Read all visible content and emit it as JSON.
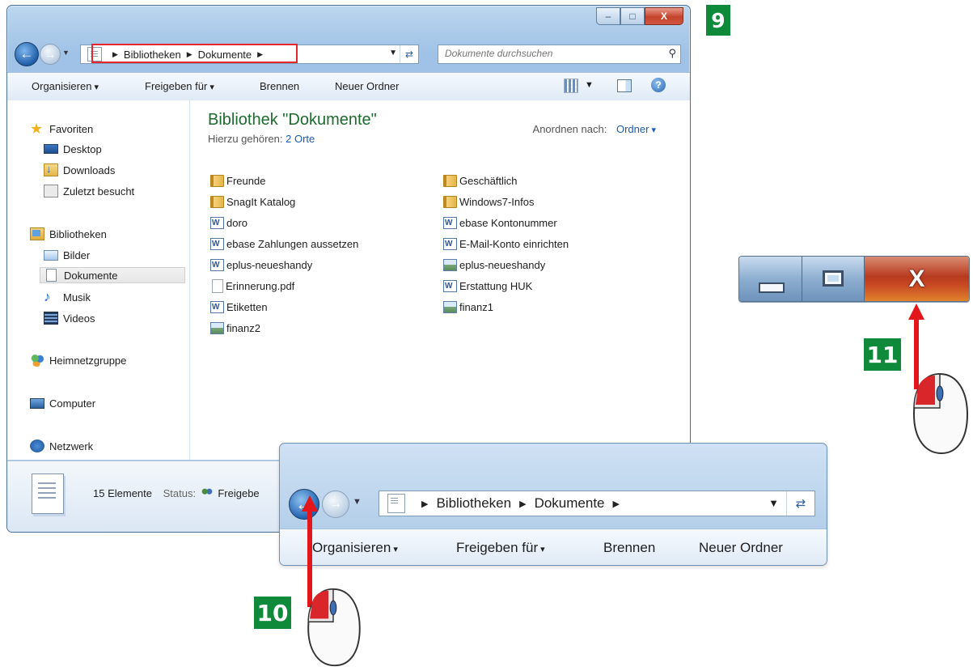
{
  "window": {
    "caption": {
      "minimize_glyph": "–",
      "maximize_glyph": "□",
      "close_glyph": "X"
    },
    "breadcrumb": [
      "Bibliotheken",
      "Dokumente"
    ],
    "search_placeholder": "Dokumente durchsuchen",
    "toolbar": {
      "organize": "Organisieren",
      "share": "Freigeben für",
      "burn": "Brennen",
      "new_folder": "Neuer Ordner"
    },
    "navigation": {
      "favorites": "Favoriten",
      "desktop": "Desktop",
      "downloads": "Downloads",
      "recent": "Zuletzt besucht",
      "libraries": "Bibliotheken",
      "pictures": "Bilder",
      "documents": "Dokumente",
      "music": "Musik",
      "videos": "Videos",
      "homegroup": "Heimnetzgruppe",
      "computer": "Computer",
      "network": "Netzwerk"
    },
    "library": {
      "title": "Bibliothek \"Dokumente\"",
      "includes_label": "Hierzu gehören:",
      "includes_value": "2 Orte",
      "arrange_label": "Anordnen nach:",
      "arrange_value": "Ordner"
    },
    "files_left": [
      {
        "name": "Freunde",
        "type": "folder"
      },
      {
        "name": "SnagIt Katalog",
        "type": "folder"
      },
      {
        "name": "doro",
        "type": "word"
      },
      {
        "name": "ebase Zahlungen aussetzen",
        "type": "word"
      },
      {
        "name": "eplus-neueshandy",
        "type": "word"
      },
      {
        "name": "Erinnerung.pdf",
        "type": "pdf"
      },
      {
        "name": "Etiketten",
        "type": "word"
      },
      {
        "name": "finanz2",
        "type": "image"
      }
    ],
    "files_right": [
      {
        "name": "Geschäftlich",
        "type": "folder"
      },
      {
        "name": "Windows7-Infos",
        "type": "folder"
      },
      {
        "name": "ebase Kontonummer",
        "type": "word"
      },
      {
        "name": "E-Mail-Konto einrichten",
        "type": "word"
      },
      {
        "name": "eplus-neueshandy",
        "type": "image"
      },
      {
        "name": "Erstattung HUK",
        "type": "word"
      },
      {
        "name": "finanz1",
        "type": "image"
      }
    ],
    "details": {
      "count": "15 Elemente",
      "status_label": "Status:",
      "status_value": "Freigebe"
    }
  },
  "steps": {
    "s9": "9",
    "s10": "10",
    "s11": "11"
  },
  "zoom_caption": {
    "close_glyph": "X"
  },
  "zoom_nav": {
    "breadcrumb": [
      "Bibliotheken",
      "Dokumente"
    ],
    "toolbar": {
      "organize": "Organisieren",
      "share": "Freigeben für",
      "burn": "Brennen",
      "new_folder": "Neuer Ordner"
    }
  },
  "colors": {
    "step_badge": "#0f8a3a",
    "arrow": "#e3161c",
    "highlight_box": "#e5262d",
    "library_title": "#1e6b2f"
  }
}
